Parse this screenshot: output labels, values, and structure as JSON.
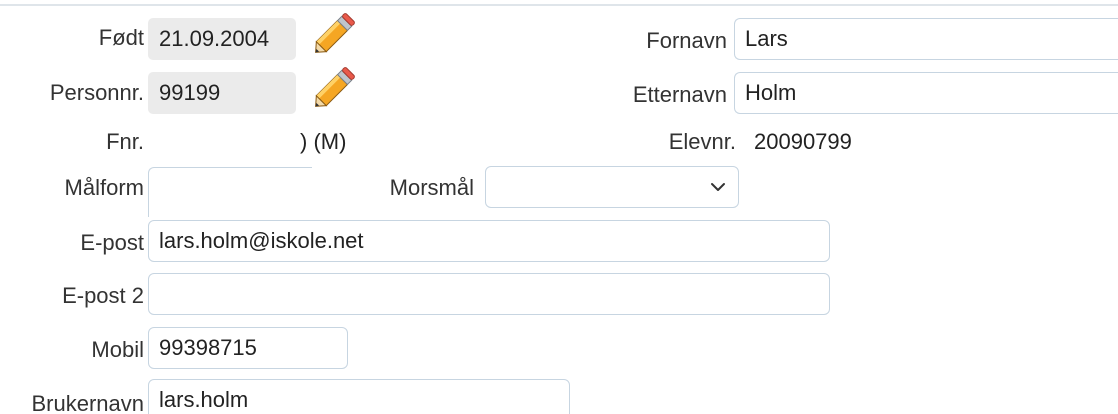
{
  "colors": {
    "input_border": "#c7d5e1",
    "readonly_bg": "#ebebeb",
    "text": "#222222",
    "pencil_body": "#f5a623",
    "pencil_tip": "#e8594a"
  },
  "left": {
    "fodt": {
      "label": "Født",
      "value": "21.09.2004",
      "edit_icon": "pencil-icon"
    },
    "personnr": {
      "label": "Personnr.",
      "value": "99199",
      "edit_icon": "pencil-icon"
    },
    "fnr": {
      "label": "Fnr.",
      "value": ") (M)"
    },
    "malform": {
      "label": "Målform",
      "value": ""
    },
    "epost": {
      "label": "E-post",
      "value": "lars.holm@iskole.net"
    },
    "epost2": {
      "label": "E-post 2",
      "value": ""
    },
    "mobil": {
      "label": "Mobil",
      "value": "99398715"
    },
    "brukernavn": {
      "label": "Brukernavn",
      "value": "lars.holm"
    }
  },
  "morsmal": {
    "label": "Morsmål",
    "value": "",
    "icon": "chevron-down-icon"
  },
  "right": {
    "fornavn": {
      "label": "Fornavn",
      "value": "Lars"
    },
    "etternavn": {
      "label": "Etternavn",
      "value": "Holm"
    },
    "elevnr": {
      "label": "Elevnr.",
      "value": "20090799"
    }
  }
}
